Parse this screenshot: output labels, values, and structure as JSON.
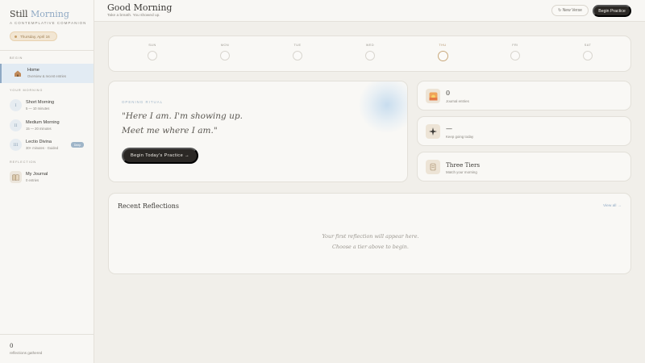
{
  "sidebar": {
    "brand_word1": "Still",
    "brand_word2": "Morning",
    "tagline": "A CONTEMPLATIVE COMPANION",
    "date": "Thursday, April 16",
    "sections": {
      "begin": "BEGIN",
      "your_morning": "YOUR MORNING",
      "reflection": "REFLECTION"
    },
    "items": [
      {
        "icon": "home-icon",
        "title": "Home",
        "subtitle": "Overview & recent entries",
        "active": true
      },
      {
        "icon": "tier-one-icon",
        "glyph": "I",
        "title": "Short Morning",
        "subtitle": "5 — 10 minutes"
      },
      {
        "icon": "tier-two-icon",
        "glyph": "II",
        "title": "Medium Morning",
        "subtitle": "15 — 20 minutes"
      },
      {
        "icon": "tier-three-icon",
        "glyph": "III",
        "title": "Lectio Divina",
        "subtitle": "30+ minutes · Guided",
        "badge": "Deep"
      },
      {
        "icon": "journal-icon",
        "title": "My Journal",
        "subtitle": "0 entries"
      }
    ],
    "footer": {
      "count": "0",
      "label": "reflections gathered"
    }
  },
  "header": {
    "title": "Good Morning",
    "subtitle": "Take a breath. You showed up.",
    "new_verse": "↻ New Verse",
    "begin": "Begin Practice"
  },
  "week": {
    "days": [
      "SUN",
      "MON",
      "TUE",
      "WED",
      "THU",
      "FRI",
      "SAT"
    ],
    "today_index": 4
  },
  "ritual": {
    "label": "OPENING RITUAL",
    "quote_line1": "\"Here I am. I'm showing up.",
    "quote_line2": "Meet me where I am.\"",
    "button": "Begin Today's Practice →"
  },
  "stats": [
    {
      "icon": "sunrise-icon",
      "value": "0",
      "label": "Journal entries"
    },
    {
      "icon": "sparkle-icon",
      "value": "—",
      "label": "Keep going today"
    },
    {
      "icon": "scroll-icon",
      "value": "Three Tiers",
      "label": "Match your morning"
    }
  ],
  "recent": {
    "title": "Recent Reflections",
    "view_all": "View all →",
    "empty_line1": "Your first reflection will appear here.",
    "empty_line2": "Choose a tier above to begin."
  },
  "colors": {
    "accent_blue": "#8fa9c4",
    "accent_gold": "#c9a97c",
    "dark": "#2b2825",
    "background": "#f1efea"
  }
}
